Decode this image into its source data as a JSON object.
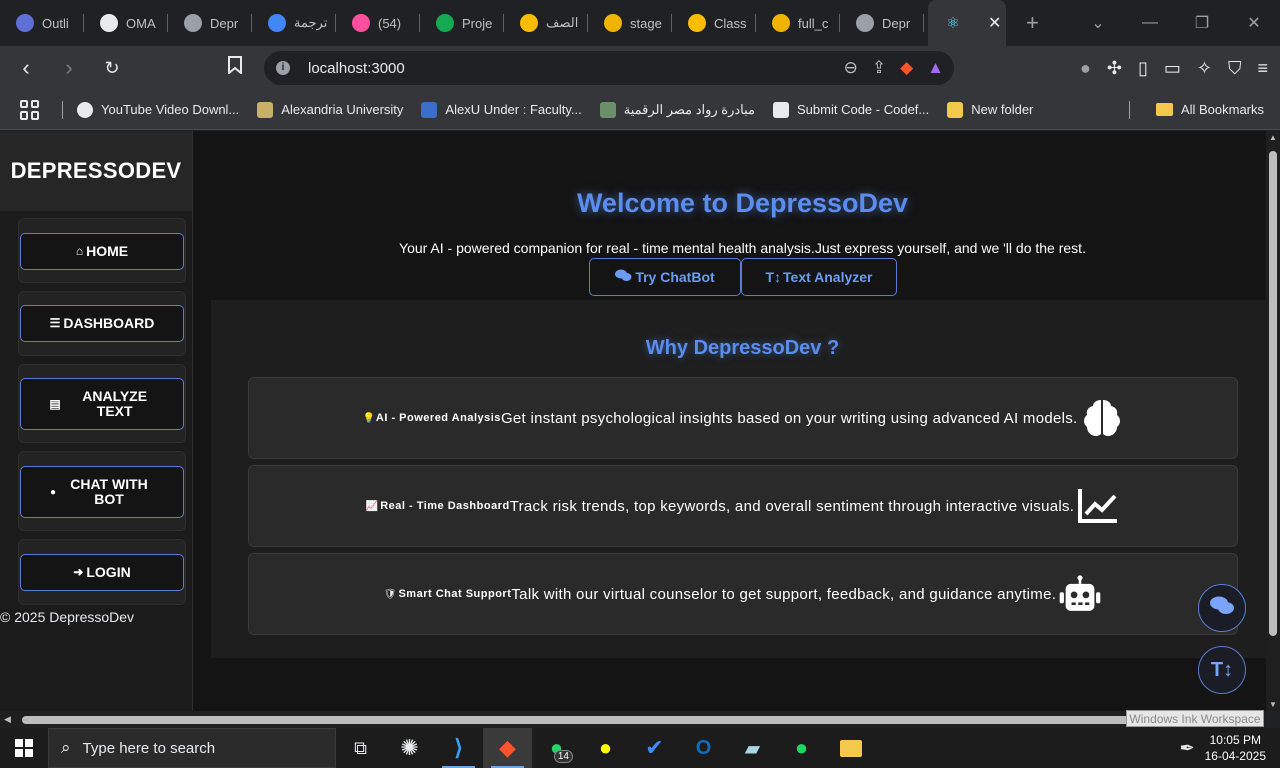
{
  "browser": {
    "tabs": [
      {
        "label": "Outli",
        "color": "#5f6fd6"
      },
      {
        "label": "OMA",
        "color": "#e8eaed"
      },
      {
        "label": "Depr",
        "color": "#9aa0a6"
      },
      {
        "label": "ترجمة",
        "color": "#4285f4"
      },
      {
        "label": "(54)",
        "color": "#ff4fa0"
      },
      {
        "label": "Proje",
        "color": "#13aa52"
      },
      {
        "label": "الصف",
        "color": "#fbbc04"
      },
      {
        "label": "stage",
        "color": "#f0b400"
      },
      {
        "label": "Class",
        "color": "#fbbc04"
      },
      {
        "label": "full_c",
        "color": "#f0b400"
      },
      {
        "label": "Depr",
        "color": "#9aa0a6"
      }
    ],
    "url": "localhost:3000",
    "bookmarks": [
      {
        "label": "YouTube Video Downl...",
        "color": "#e8eaed"
      },
      {
        "label": "Alexandria University",
        "color": "#c8b06a"
      },
      {
        "label": "AlexU Under : Faculty...",
        "color": "#3b6fc9"
      },
      {
        "label": "مبادرة رواد مصر الرقمية",
        "color": "#6b8e6b"
      },
      {
        "label": "Submit Code - Codef...",
        "color": "#e8eaed"
      },
      {
        "label": "New folder",
        "color": "#f2c94c"
      }
    ],
    "all_bookmarks": "All Bookmarks"
  },
  "sidebar": {
    "brand": "DEPRESSODEV",
    "items": [
      {
        "label": "HOME",
        "icon": "home-icon",
        "glyph": "⌂"
      },
      {
        "label": "DASHBOARD",
        "icon": "dashboard-icon",
        "glyph": "☰"
      },
      {
        "label": "ANALYZE TEXT",
        "icon": "document-icon",
        "glyph": "▤"
      },
      {
        "label": "CHAT WITH BOT",
        "icon": "chat-icon",
        "glyph": "●"
      },
      {
        "label": "LOGIN",
        "icon": "login-icon",
        "glyph": "➜"
      }
    ],
    "footer": "© 2025 DepressoDev"
  },
  "hero": {
    "title": "Welcome to DepressoDev",
    "subtitle": "Your AI - powered companion for real - time mental health analysis.Just express yourself, and we 'll do the rest.",
    "cta_chatbot": "Try ChatBot",
    "cta_analyzer": "Text Analyzer"
  },
  "why": {
    "title": "Why DepressoDev ?",
    "features": [
      {
        "label": "AI - Powered Analysis",
        "description": "Get instant psychological insights based on your writing using advanced AI models.",
        "icon": "brain-icon",
        "emoji": "💡"
      },
      {
        "label": "Real - Time Dashboard",
        "description": "Track risk trends, top keywords, and overall sentiment through interactive visuals.",
        "icon": "chart-line-icon",
        "emoji": "📈"
      },
      {
        "label": "Smart Chat Support",
        "description": "Talk with our virtual counselor to get support, feedback, and guidance anytime.",
        "icon": "robot-icon",
        "emoji": "🛡"
      }
    ]
  },
  "tooltip": "Windows Ink Workspace",
  "taskbar": {
    "search_placeholder": "Type here to search",
    "time": "10:05 PM",
    "date": "16-04-2025",
    "whatsapp_badge": "14"
  }
}
